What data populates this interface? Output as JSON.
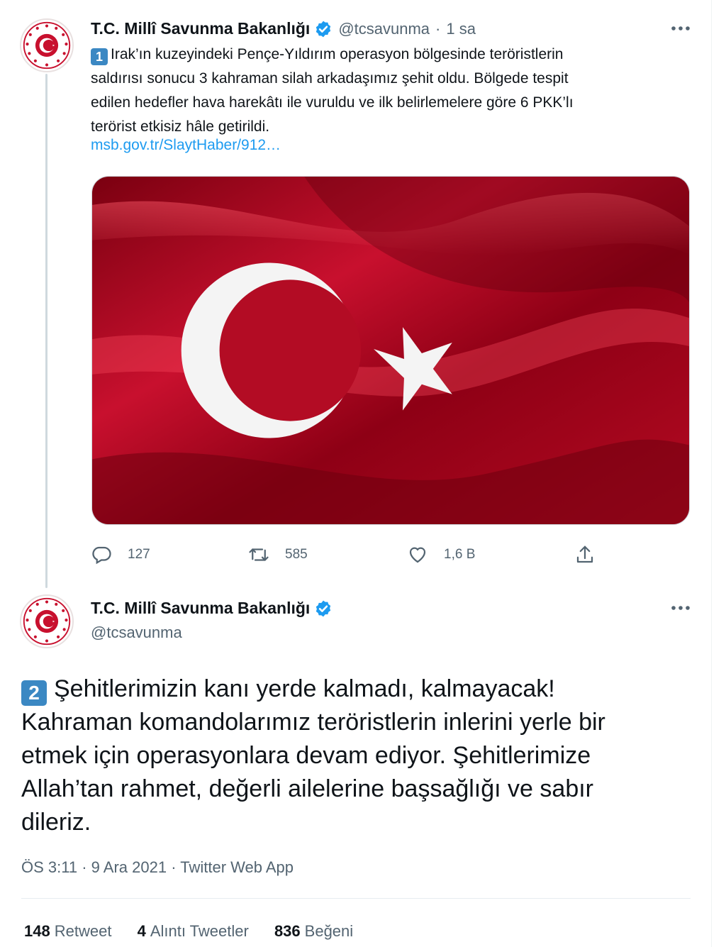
{
  "tweet1": {
    "display_name": "T.C. Millî Savunma Bakanlığı",
    "handle": "@tcsavunma",
    "separator": "·",
    "time": "1 sa",
    "badge": "1",
    "text_lines": [
      "Irak’ın kuzeyindeki Pençe-Yıldırım operasyon bölgesinde teröristlerin",
      "saldırısı sonucu 3 kahraman silah arkadaşımız şehit oldu. Bölgede tespit",
      "edilen hedefler hava harekâtı ile vuruldu ve ilk belirlemelere göre 6 PKK’lı",
      "terörist etkisiz hâle getirildi."
    ],
    "link": "msb.gov.tr/SlaytHaber/912…",
    "actions": {
      "reply_count": "127",
      "retweet_count": "585",
      "like_count": "1,6 B"
    }
  },
  "tweet2": {
    "display_name": "T.C. Millî Savunma Bakanlığı",
    "handle": "@tcsavunma",
    "badge": "2",
    "text_lines": [
      "Şehitlerimizin kanı yerde kalmadı, kalmayacak!",
      "Kahraman komandolarımız teröristlerin inlerini yerle bir",
      "etmek için operasyonlara devam ediyor. Şehitlerimize",
      "Allah’tan rahmet, değerli ailelerine başsağlığı ve sabır",
      "dileriz."
    ],
    "time": "ÖS 3:11",
    "date": "9 Ara 2021",
    "source": "Twitter Web App",
    "meta_separator": " · ",
    "stats": {
      "retweets_count": "148",
      "retweets_label": "Retweet",
      "quotes_count": "4",
      "quotes_label": "Alıntı Tweetler",
      "likes_count": "836",
      "likes_label": "Beğeni"
    }
  },
  "colors": {
    "accent": "#1d9bf0",
    "muted": "#536471",
    "badge": "#3b88c3",
    "flag_red": "#c8102e"
  },
  "icons": [
    "verified-badge-icon",
    "more-icon",
    "reply-icon",
    "retweet-icon",
    "like-icon",
    "share-icon"
  ]
}
